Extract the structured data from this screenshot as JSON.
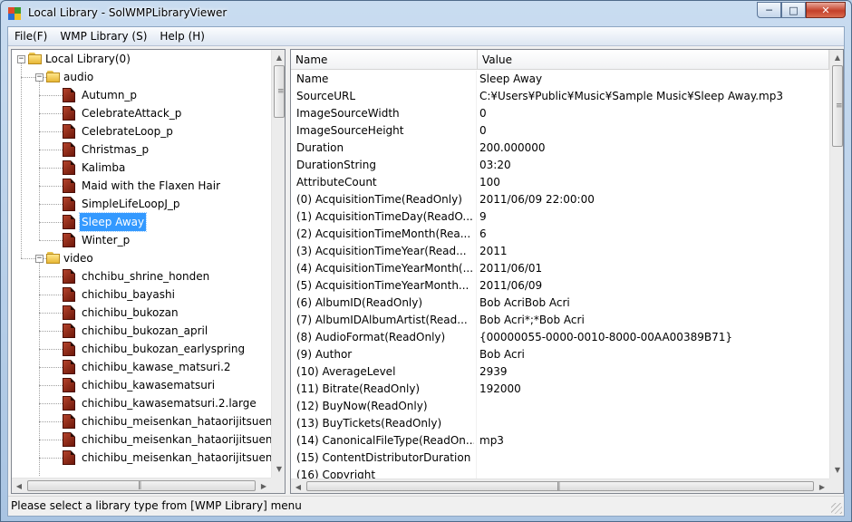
{
  "window": {
    "title": "Local Library - SolWMPLibraryViewer"
  },
  "menu": [
    {
      "label": "File(F)"
    },
    {
      "label": "WMP Library (S)"
    },
    {
      "label": "Help (H)"
    }
  ],
  "tree": {
    "root": "Local Library(0)",
    "audio_label": "audio",
    "audio_items": [
      "Autumn_p",
      "CelebrateAttack_p",
      "CelebrateLoop_p",
      "Christmas_p",
      "Kalimba",
      "Maid with the Flaxen Hair",
      "SimpleLifeLoopJ_p",
      "Sleep Away",
      "Winter_p"
    ],
    "selected": "Sleep Away",
    "video_label": "video",
    "video_items": [
      "chchibu_shrine_honden",
      "chichibu_bayashi",
      "chichibu_bukozan",
      "chichibu_bukozan_april",
      "chichibu_bukozan_earlyspring",
      "chichibu_kawase_matsuri.2",
      "chichibu_kawasematsuri",
      "chichibu_kawasematsuri.2.large",
      "chichibu_meisenkan_hataorijitsuen",
      "chichibu_meisenkan_hataorijitsuen",
      "chichibu_meisenkan_hataorijitsuen"
    ]
  },
  "grid": {
    "columns": {
      "name": "Name",
      "value": "Value"
    },
    "rows": [
      {
        "name": "Name",
        "value": "Sleep Away"
      },
      {
        "name": "SourceURL",
        "value": "C:¥Users¥Public¥Music¥Sample Music¥Sleep Away.mp3"
      },
      {
        "name": "ImageSourceWidth",
        "value": "0"
      },
      {
        "name": "ImageSourceHeight",
        "value": "0"
      },
      {
        "name": "Duration",
        "value": "200.000000"
      },
      {
        "name": "DurationString",
        "value": "03:20"
      },
      {
        "name": "AttributeCount",
        "value": "100"
      },
      {
        "name": "(0) AcquisitionTime(ReadOnly)",
        "value": "2011/06/09 22:00:00"
      },
      {
        "name": "(1) AcquisitionTimeDay(ReadO...",
        "value": "9"
      },
      {
        "name": "(2) AcquisitionTimeMonth(Rea...",
        "value": "6"
      },
      {
        "name": "(3) AcquisitionTimeYear(Read...",
        "value": "2011"
      },
      {
        "name": "(4) AcquisitionTimeYearMonth(...",
        "value": "2011/06/01"
      },
      {
        "name": "(5) AcquisitionTimeYearMonth...",
        "value": "2011/06/09"
      },
      {
        "name": "(6) AlbumID(ReadOnly)",
        "value": "Bob AcriBob Acri"
      },
      {
        "name": "(7) AlbumIDAlbumArtist(Read...",
        "value": "Bob Acri*;*Bob Acri"
      },
      {
        "name": "(8) AudioFormat(ReadOnly)",
        "value": "{00000055-0000-0010-8000-00AA00389B71}"
      },
      {
        "name": "(9) Author",
        "value": "Bob Acri"
      },
      {
        "name": "(10) AverageLevel",
        "value": "2939"
      },
      {
        "name": "(11) Bitrate(ReadOnly)",
        "value": "192000"
      },
      {
        "name": "(12) BuyNow(ReadOnly)",
        "value": ""
      },
      {
        "name": "(13) BuyTickets(ReadOnly)",
        "value": ""
      },
      {
        "name": "(14) CanonicalFileType(ReadOn...",
        "value": "mp3"
      },
      {
        "name": "(15) ContentDistributorDuration",
        "value": ""
      },
      {
        "name": "(16) Copyright",
        "value": ""
      }
    ]
  },
  "status": {
    "text": "Please select a library type from [WMP Library] menu"
  }
}
